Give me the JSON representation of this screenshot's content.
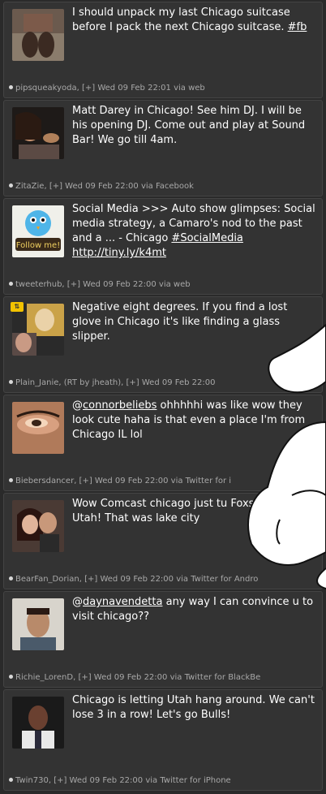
{
  "tweets": [
    {
      "text": "I should unpack my last Chicago suitcase before I pack the next Chicago suitcase. ",
      "link": "#fb",
      "meta": "pipsqueakyoda, [+] Wed 09 Feb 22:01 via web"
    },
    {
      "text": "Matt Darey in Chicago! See him DJ. I will be his opening DJ. Come out and play at Sound Bar! We go till 4am.",
      "link": "",
      "meta": "ZitaZie, [+] Wed 09 Feb 22:00 via Facebook"
    },
    {
      "text": "Social Media >>> Auto show glimpses: Social media strategy, a Camaro's nod to the past and a ... - Chicago ",
      "link": "#SocialMedia",
      "link2": "http://tiny.ly/k4mt",
      "meta": "tweeterhub, [+] Wed 09 Feb 22:00 via web",
      "avatar_label": "Follow me!"
    },
    {
      "text": "Negative eight degrees. If you find a lost glove in Chicago it's like finding a glass slipper.",
      "link": "",
      "meta": "Plain_Janie, (RT by jheath), [+] Wed 09 Feb 22:00"
    },
    {
      "text_prefix": "@",
      "mention": "connorbeliebs",
      "text": " ohhhhhi was like wow they look cute haha is that even a place I'm from Chicago IL lol",
      "meta": "Biebersdancer, [+] Wed 09 Feb 22:00 via Twitter for i"
    },
    {
      "text": "Wow Comcast chicago just tu FoxsportsNet Utah! That was lake city",
      "link": "",
      "meta": "BearFan_Dorian, [+] Wed 09 Feb 22:00 via Twitter for Andro"
    },
    {
      "text_prefix": "@",
      "mention": "daynavendetta",
      "text": " any way I can convince u to visit chicago??",
      "meta": "Richie_LorenD, [+] Wed 09 Feb 22:00 via Twitter for BlackBe"
    },
    {
      "text": "Chicago is letting Utah hang around. We can't lose 3 in a row! Let's go Bulls!",
      "link": "",
      "meta": "Twin730, [+] Wed 09 Feb 22:00 via Twitter for iPhone"
    }
  ],
  "colors": {
    "background": "#2a2a2a",
    "card": "#333333",
    "text": "#ffffff",
    "meta": "#a8a8a8",
    "retweet_badge": "#f2c200"
  },
  "icons": [
    "avatar-image",
    "retweet-icon",
    "hand-overlay"
  ]
}
